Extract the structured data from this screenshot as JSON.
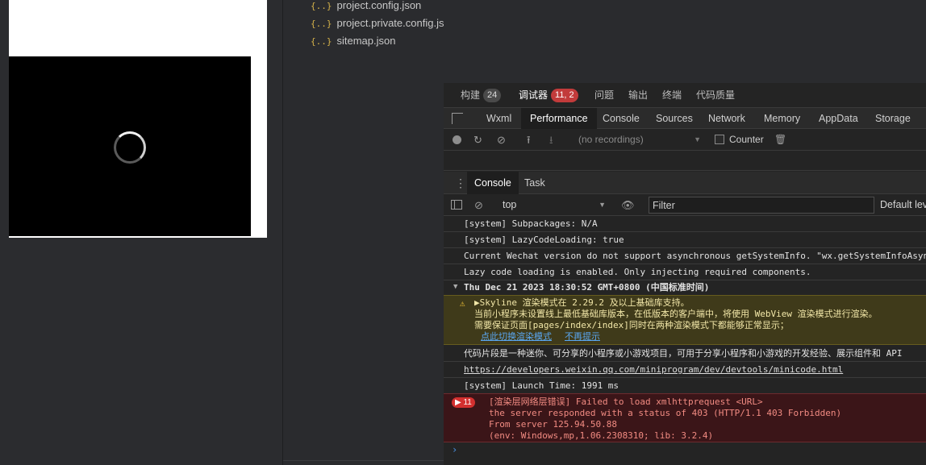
{
  "file_tree": {
    "items": [
      {
        "icon": "json-icon",
        "glyph": "{..}",
        "name": "project.config.json"
      },
      {
        "icon": "json-icon",
        "glyph": "{..}",
        "name": "project.private.config.js..."
      },
      {
        "icon": "json-icon",
        "glyph": "{..}",
        "name": "sitemap.json"
      }
    ]
  },
  "top_tabs": {
    "build": {
      "label": "构建",
      "badge": "24"
    },
    "debugger": {
      "label": "调试器",
      "badge": "11, 2"
    },
    "issues": "问题",
    "output": "输出",
    "terminal": "终端",
    "code_quality": "代码质量"
  },
  "panel_tabs": [
    "Wxml",
    "Performance",
    "Console",
    "Sources",
    "Network",
    "Memory",
    "AppData",
    "Storage"
  ],
  "perf_toolbar": {
    "recordings": "(no recordings)",
    "counter_label": "Counter"
  },
  "drawer_tabs": [
    "Console",
    "Task"
  ],
  "console_toolbar": {
    "context": "top",
    "filter_placeholder": "Filter",
    "levels": "Default levels"
  },
  "console": {
    "lines": [
      "[system] Subpackages: N/A",
      "[system] LazyCodeLoading: true",
      "Current Wechat version do not support asynchronous getSystemInfo. \"wx.getSystemInfoAsync\"",
      "Lazy code loading is enabled. Only injecting required components."
    ],
    "group_header": "Thu Dec 21 2023 18:30:52 GMT+0800 (中国标准时间)",
    "warning": {
      "line1": "▶Skyline 渲染模式在 2.29.2 及以上基础库支持。",
      "line2": "当前小程序未设置线上最低基础库版本，在低版本的客户端中，将使用 WebView 渲染模式进行渲染。",
      "line3": "需要保证页面[pages/index/index]同时在两种渲染模式下都能够正常显示；",
      "link1": "点此切换渲染模式",
      "link2": "不再提示"
    },
    "info_line": "代码片段是一种迷你、可分享的小程序或小游戏项目，可用于分享小程序和小游戏的开发经验、展示组件和 API",
    "url_line": "https://developers.weixin.qq.com/miniprogram/dev/devtools/minicode.html",
    "launch_line": "[system] Launch Time: 1991 ms",
    "error": {
      "count": "11",
      "line1": "[渲染层网络层错误] Failed to load xmlhttprequest <URL>",
      "line2": "the server responded with a status of 403 (HTTP/1.1 403 Forbidden)",
      "line3": "From server 125.94.50.88",
      "line4": "(env: Windows,mp,1.06.2308310; lib: 3.2.4)"
    },
    "prompt": "›"
  }
}
